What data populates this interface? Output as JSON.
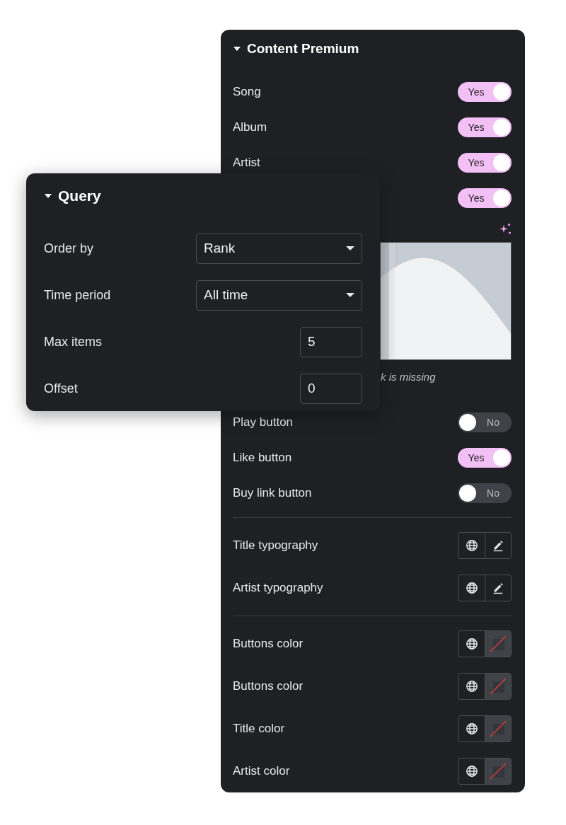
{
  "content_panel": {
    "title": "Content Premium",
    "expanded": true,
    "rows": [
      {
        "kind": "toggle",
        "label": "Song",
        "on": true,
        "state_label": "Yes"
      },
      {
        "kind": "toggle",
        "label": "Album",
        "on": true,
        "state_label": "Yes"
      },
      {
        "kind": "toggle",
        "label": "Artist",
        "on": true,
        "state_label": "Yes"
      },
      {
        "kind": "toggle",
        "on": true,
        "state_label": "Yes"
      },
      {
        "caption": "k is missing"
      },
      {
        "kind": "toggle",
        "label": "Play button",
        "on": false,
        "state_label": "No"
      },
      {
        "kind": "toggle",
        "label": "Like button",
        "on": true,
        "state_label": "Yes"
      },
      {
        "kind": "toggle",
        "label": "Buy link button",
        "on": false,
        "state_label": "No"
      },
      {
        "kind": "divider"
      },
      {
        "kind": "typography",
        "label": "Title typography"
      },
      {
        "kind": "typography",
        "label": "Artist typography"
      },
      {
        "kind": "divider"
      },
      {
        "kind": "color",
        "label": "Buttons color"
      },
      {
        "kind": "color",
        "label": "Buttons color"
      },
      {
        "kind": "color",
        "label": "Title color"
      },
      {
        "kind": "color",
        "label": "Artist color"
      }
    ]
  },
  "query_panel": {
    "title": "Query",
    "expanded": true,
    "fields": [
      {
        "kind": "select",
        "label": "Order by",
        "value": "Rank"
      },
      {
        "kind": "select",
        "label": "Time period",
        "value": "All time"
      },
      {
        "kind": "number",
        "label": "Max items",
        "value": "5"
      },
      {
        "kind": "number",
        "label": "Offset",
        "value": "0"
      }
    ]
  }
}
